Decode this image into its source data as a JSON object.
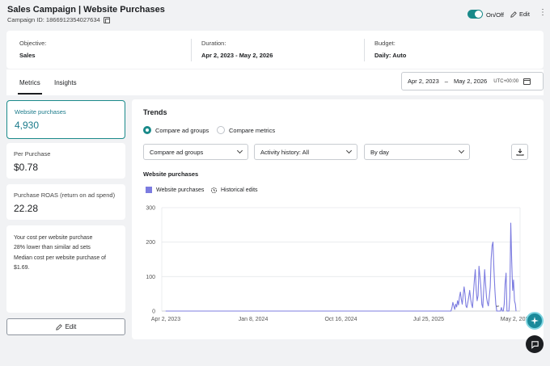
{
  "header": {
    "title": "Sales Campaign | Website Purchases",
    "campaign_id": "Campaign ID: 1866912354027634",
    "toggle_label": "On/Off",
    "edit_label": "Edit",
    "more_icon": "kebab-icon"
  },
  "summary": {
    "objective_label": "Objective:",
    "objective_value": "Sales",
    "duration_label": "Duration:",
    "duration_value": "Apr 2, 2023 - May 2, 2026",
    "budget_label": "Budget:",
    "budget_value": "Daily: Auto"
  },
  "tabs": [
    {
      "label": "Metrics",
      "active": true
    },
    {
      "label": "Insights",
      "active": false
    }
  ],
  "date_range": {
    "start": "Apr 2, 2023",
    "separator": "–",
    "end": "May 2, 2026",
    "timezone": "UTC+00:00"
  },
  "metrics": [
    {
      "label": "Website purchases",
      "value": "4,930",
      "selected": true
    },
    {
      "label": "Per Purchase",
      "value": "$0.78",
      "selected": false
    },
    {
      "label": "Purchase ROAS (return on ad spend)",
      "value": "22.28",
      "selected": false
    }
  ],
  "cost_note": {
    "line1": "Your cost per website purchase",
    "line2": "28% lower than similar ad sets",
    "line3": "Median cost per website purchase of $1.69."
  },
  "edit_button": "Edit",
  "trends": {
    "title": "Trends",
    "radio_options": [
      {
        "label": "Compare ad groups",
        "selected": true
      },
      {
        "label": "Compare metrics",
        "selected": false
      }
    ],
    "selects": [
      "Compare ad groups",
      "Activity history: All",
      "By day"
    ],
    "chart_title": "Website purchases",
    "legend_series": "Website purchases",
    "legend_edits": "Historical edits"
  },
  "chart_data": {
    "type": "line",
    "title": "Website purchases",
    "xlabel": "",
    "ylabel": "",
    "ylim": [
      0,
      300
    ],
    "yticks": [
      "0",
      "100",
      "200",
      "300"
    ],
    "xticks": [
      "Apr 2, 2023",
      "Jan 8, 2024",
      "Oct 16, 2024",
      "Jul 25, 2025",
      "May 2, 2026"
    ],
    "grid": true,
    "color": "#7c7ce0",
    "series": [
      {
        "name": "Website purchases",
        "x": [
          "2023-04-02",
          "2024-01-08",
          "2024-10-16",
          "2025-07-25",
          "2025-10-05",
          "2025-10-08",
          "2025-10-11",
          "2025-10-14",
          "2025-10-17",
          "2025-10-20",
          "2025-10-23",
          "2025-10-26",
          "2025-10-29",
          "2025-11-01",
          "2025-11-04",
          "2025-11-07",
          "2025-11-10",
          "2025-11-13",
          "2025-11-16",
          "2025-11-19",
          "2025-11-22",
          "2025-11-25",
          "2025-11-28",
          "2025-12-01",
          "2025-12-04",
          "2025-12-07",
          "2025-12-10",
          "2025-12-13",
          "2025-12-16",
          "2025-12-19",
          "2025-12-22",
          "2025-12-25",
          "2025-12-28",
          "2025-12-31",
          "2026-01-03",
          "2026-01-06",
          "2026-01-09",
          "2026-01-12",
          "2026-01-15",
          "2026-01-18",
          "2026-01-21",
          "2026-01-24",
          "2026-01-27",
          "2026-01-30",
          "2026-02-02",
          "2026-02-05",
          "2026-02-08",
          "2026-02-11",
          "2026-02-14",
          "2026-02-17",
          "2026-02-20",
          "2026-02-23",
          "2026-02-26",
          "2026-03-01",
          "2026-03-04",
          "2026-03-07",
          "2026-03-10",
          "2026-03-13",
          "2026-03-16",
          "2026-03-19",
          "2026-03-22",
          "2026-03-25",
          "2026-03-28",
          "2026-03-31",
          "2026-04-03",
          "2026-04-06",
          "2026-04-09",
          "2026-04-12",
          "2026-04-15",
          "2026-04-18",
          "2026-04-21",
          "2026-04-24",
          "2026-04-27",
          "2026-04-30",
          "2026-05-02"
        ],
        "y": [
          0,
          0,
          0,
          0,
          0,
          10,
          25,
          15,
          5,
          20,
          12,
          30,
          18,
          40,
          55,
          35,
          20,
          45,
          70,
          50,
          15,
          10,
          25,
          40,
          60,
          35,
          20,
          10,
          50,
          90,
          120,
          60,
          30,
          45,
          130,
          100,
          70,
          20,
          10,
          60,
          120,
          80,
          40,
          25,
          15,
          40,
          70,
          150,
          190,
          200,
          120,
          60,
          20,
          0,
          0,
          0,
          0,
          0,
          10,
          0,
          0,
          20,
          80,
          110,
          0,
          0,
          0,
          40,
          255,
          150,
          60,
          90,
          30,
          20,
          0
        ]
      }
    ]
  }
}
